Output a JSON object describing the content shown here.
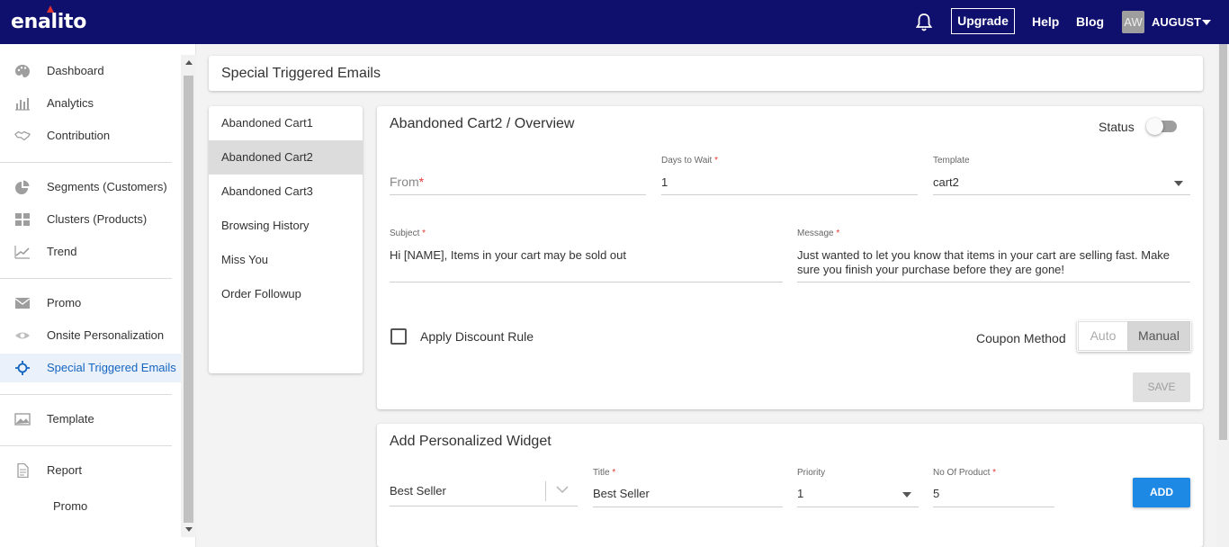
{
  "topbar": {
    "logo": "enalito",
    "upgrade_label": "Upgrade",
    "help_label": "Help",
    "blog_label": "Blog",
    "avatar_initials": "AW",
    "username": "AUGUST",
    "brand_color": "#0f0f6e",
    "logo_accent_color": "#e0332f"
  },
  "sidebar": {
    "items": [
      {
        "label": "Dashboard",
        "icon": "palette-icon"
      },
      {
        "label": "Analytics",
        "icon": "bar-chart-icon"
      },
      {
        "label": "Contribution",
        "icon": "handshake-icon"
      },
      {
        "label": "Segments (Customers)",
        "icon": "pie-chart-icon"
      },
      {
        "label": "Clusters (Products)",
        "icon": "grid-icon"
      },
      {
        "label": "Trend",
        "icon": "trend-icon"
      },
      {
        "label": "Promo",
        "icon": "mail-icon"
      },
      {
        "label": "Onsite Personalization",
        "icon": "eye-icon"
      },
      {
        "label": "Special Triggered Emails",
        "icon": "crosshair-icon",
        "active": true
      },
      {
        "label": "Template",
        "icon": "image-icon"
      },
      {
        "label": "Report",
        "icon": "document-icon"
      },
      {
        "label": "Promo",
        "icon": ""
      }
    ],
    "active_color": "#1565c0"
  },
  "page": {
    "title": "Special Triggered Emails"
  },
  "email_list": [
    {
      "label": "Abandoned Cart1"
    },
    {
      "label": "Abandoned Cart2",
      "active": true
    },
    {
      "label": "Abandoned Cart3"
    },
    {
      "label": "Browsing History"
    },
    {
      "label": "Miss You"
    },
    {
      "label": "Order Followup"
    }
  ],
  "overview": {
    "title": "Abandoned Cart2 / Overview",
    "status_label": "Status",
    "status_on": false,
    "from_placeholder": "From",
    "days_label": "Days to Wait",
    "days_value": "1",
    "template_label": "Template",
    "template_value": "cart2",
    "subject_label": "Subject",
    "subject_value": "Hi [NAME], Items in your cart may be sold out",
    "message_label": "Message",
    "message_line1": "Just wanted to let you know that items in your cart are selling fast. Make",
    "message_line2": "sure you finish your purchase before they are gone!",
    "apply_discount_label": "Apply Discount Rule",
    "apply_discount_checked": false,
    "coupon_method_label": "Coupon Method",
    "coupon_options": [
      "Auto",
      "Manual"
    ],
    "coupon_selected": "Manual",
    "save_label": "SAVE"
  },
  "widget": {
    "title": "Add Personalized Widget",
    "widget_type_value": "Best Seller",
    "title_label": "Title",
    "title_value": "Best Seller",
    "priority_label": "Priority",
    "priority_value": "1",
    "no_of_product_label": "No Of Product",
    "no_of_product_value": "5",
    "add_label": "ADD",
    "add_color": "#1e88e5"
  }
}
